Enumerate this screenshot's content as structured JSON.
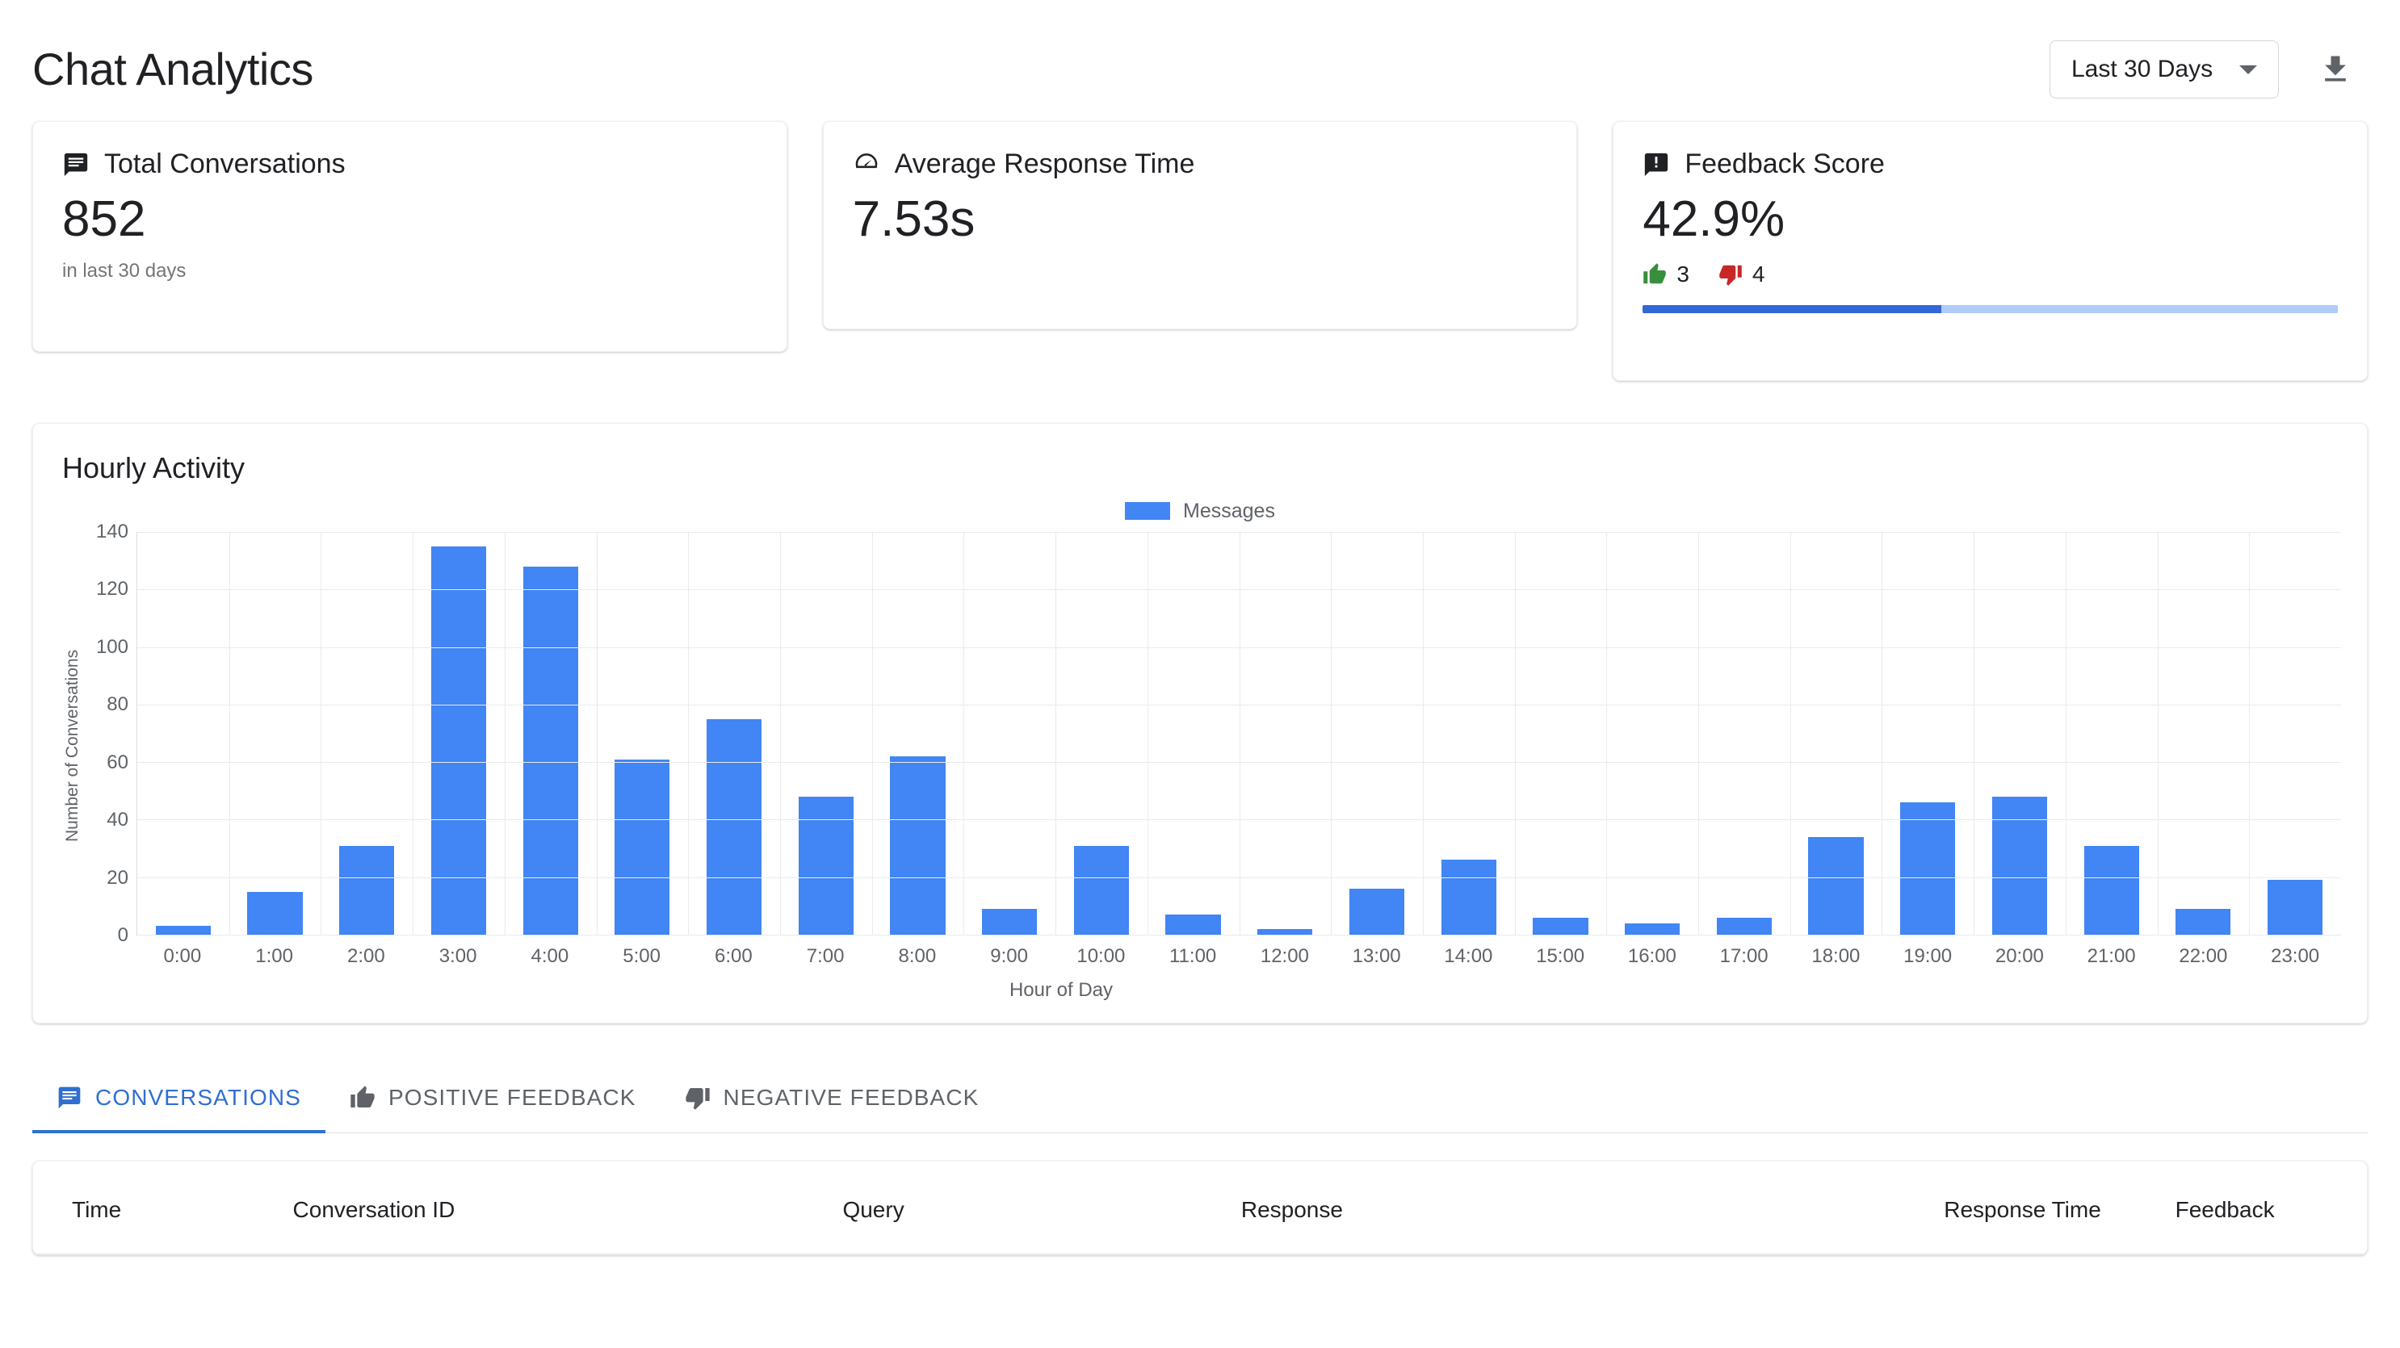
{
  "header": {
    "title": "Chat Analytics",
    "range_label": "Last 30 Days",
    "download_icon": "download-icon",
    "caret_icon": "chevron-down-icon"
  },
  "kpis": [
    {
      "icon": "chat-bubble-icon",
      "title": "Total Conversations",
      "value": "852",
      "sub": "in last 30 days"
    },
    {
      "icon": "speed-gauge-icon",
      "title": "Average Response Time",
      "value": "7.53s",
      "sub": ""
    },
    {
      "icon": "feedback-icon",
      "title": "Feedback Score",
      "value": "42.9%",
      "thumbs_up_count": "3",
      "thumbs_down_count": "4",
      "progress_percent": 42.9,
      "progress_fill_color": "#3367d6",
      "progress_track_color": "#aecbfa",
      "thumbs_up_color": "#388e3c",
      "thumbs_down_color": "#c62828"
    }
  ],
  "chart_card": {
    "title": "Hourly Activity"
  },
  "chart_data": {
    "type": "bar",
    "title": "Hourly Activity",
    "xlabel": "Hour of Day",
    "ylabel": "Number of Conversations",
    "legend": [
      "Messages"
    ],
    "legend_position": "top",
    "grid": true,
    "ylim": [
      0,
      140
    ],
    "yticks": [
      140,
      120,
      100,
      80,
      60,
      40,
      20,
      0
    ],
    "categories": [
      "0:00",
      "1:00",
      "2:00",
      "3:00",
      "4:00",
      "5:00",
      "6:00",
      "7:00",
      "8:00",
      "9:00",
      "10:00",
      "11:00",
      "12:00",
      "13:00",
      "14:00",
      "15:00",
      "16:00",
      "17:00",
      "18:00",
      "19:00",
      "20:00",
      "21:00",
      "22:00",
      "23:00"
    ],
    "series": [
      {
        "name": "Messages",
        "color": "#4285f4",
        "values": [
          3,
          15,
          31,
          135,
          128,
          61,
          75,
          48,
          62,
          9,
          31,
          7,
          2,
          16,
          26,
          6,
          4,
          6,
          34,
          46,
          48,
          31,
          9,
          19
        ]
      }
    ]
  },
  "tabs": [
    {
      "label": "Conversations",
      "icon": "chat-bubble-icon",
      "active": true
    },
    {
      "label": "Positive Feedback",
      "icon": "thumb-up-icon",
      "active": false
    },
    {
      "label": "Negative Feedback",
      "icon": "thumb-down-icon",
      "active": false
    }
  ],
  "table": {
    "columns": [
      "Time",
      "Conversation ID",
      "Query",
      "Response",
      "Response Time",
      "Feedback"
    ],
    "rows": []
  }
}
